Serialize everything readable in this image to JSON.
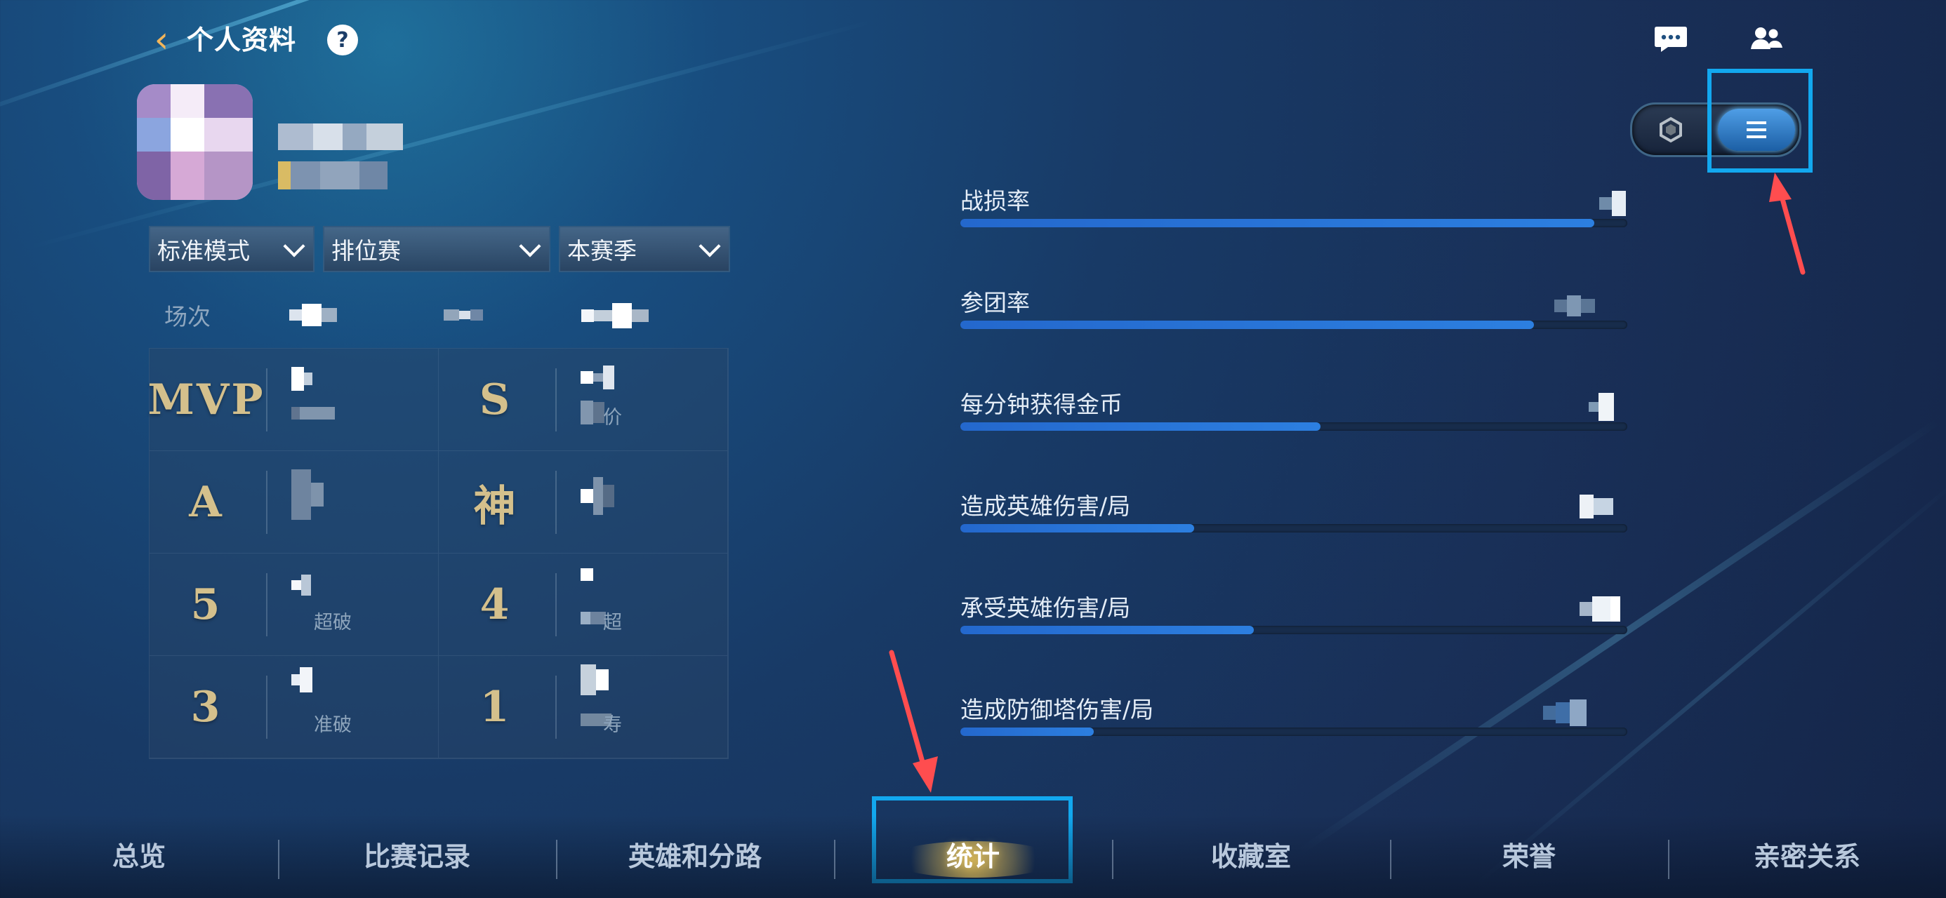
{
  "header": {
    "back_icon": "chevron-left-icon",
    "title": "个人资料",
    "help_icon": "help-icon",
    "chat_icon": "chat-icon",
    "friends_icon": "friends-icon"
  },
  "filters": [
    {
      "label": "标准模式"
    },
    {
      "label": "排位赛"
    },
    {
      "label": "本赛季"
    }
  ],
  "summary": {
    "matches_label": "场次"
  },
  "stat_cells": [
    {
      "badge": "MVP",
      "caption": ""
    },
    {
      "badge": "S",
      "caption": "价"
    },
    {
      "badge": "A",
      "caption": ""
    },
    {
      "badge": "神",
      "caption": ""
    },
    {
      "badge": "5",
      "caption": "超破"
    },
    {
      "badge": "4",
      "caption": "超"
    },
    {
      "badge": "3",
      "caption": "准破"
    },
    {
      "badge": "1",
      "caption": "寿"
    }
  ],
  "metrics": [
    {
      "label": "战损率",
      "progress_percent": 95
    },
    {
      "label": "参团率",
      "progress_percent": 86
    },
    {
      "label": "每分钟获得金币",
      "progress_percent": 54
    },
    {
      "label": "造成英雄伤害/局",
      "progress_percent": 35
    },
    {
      "label": "承受英雄伤害/局",
      "progress_percent": 44
    },
    {
      "label": "造成防御塔伤害/局",
      "progress_percent": 20
    }
  ],
  "view_toggle": {
    "left_icon": "hexagon-icon",
    "right_icon": "list-icon",
    "selected": "list"
  },
  "bottom_nav": [
    {
      "label": "总览"
    },
    {
      "label": "比赛记录"
    },
    {
      "label": "英雄和分路"
    },
    {
      "label": "统计",
      "active": true
    },
    {
      "label": "收藏室"
    },
    {
      "label": "荣誉"
    },
    {
      "label": "亲密关系"
    }
  ],
  "colors": {
    "accent_blue": "#12a8ef",
    "progress_blue": "#2468cd",
    "badge_gold": "#d4c08c",
    "annotation_red": "#ff4d4f"
  }
}
